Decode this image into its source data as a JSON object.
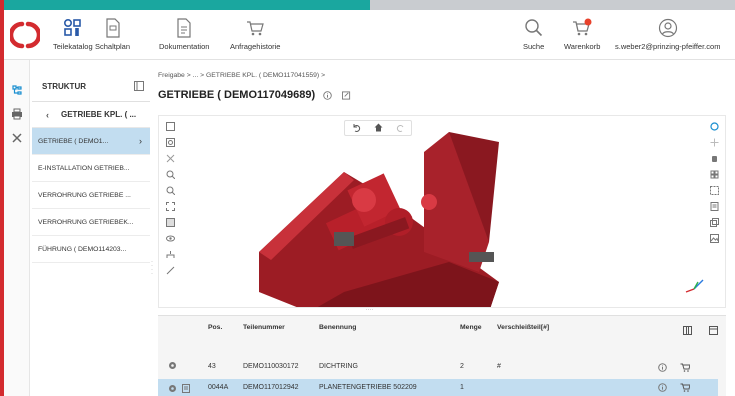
{
  "header": {
    "nav": [
      {
        "label": "Teilekatalog",
        "icon": "catalog-icon"
      },
      {
        "label": "Schaltplan",
        "icon": "circuit-diagram-icon"
      },
      {
        "label": "Dokumentation",
        "icon": "documentation-icon"
      },
      {
        "label": "Anfragehistorie",
        "icon": "request-history-icon"
      }
    ],
    "search_label": "Suche",
    "cart_label": "Warenkorb",
    "user_email": "s.weber2@prinzing-pfeiffer.com",
    "cart_badge_color": "#e8412b"
  },
  "structure": {
    "heading": "STRUKTUR",
    "parent": "GETRIEBE KPL. ( ...",
    "items": [
      {
        "label": "GETRIEBE ( DEMO1..."
      },
      {
        "label": "E-INSTALLATION GETRIEB..."
      },
      {
        "label": "VERROHRUNG GETRIEBE ..."
      },
      {
        "label": "VERROHRUNG GETRIEBEK..."
      },
      {
        "label": "FÜHRUNG ( DEMO114203..."
      }
    ]
  },
  "breadcrumb": "Freigabe > ... > GETRIEBE KPL. ( DEMO117041559) >",
  "title": "GETRIEBE ( DEMO117049689)",
  "table": {
    "columns": {
      "pos": "Pos.",
      "part": "Teilenummer",
      "name": "Benennung",
      "qty": "Menge",
      "wear": "Verschleißteil[#]"
    },
    "rows": [
      {
        "pos": "43",
        "part": "DEMO110030172",
        "name": "DICHTRING",
        "qty": "2",
        "wear": "#"
      },
      {
        "pos": "0044A",
        "part": "DEMO117012942",
        "name": "PLANETENGETRIEBE 502209",
        "qty": "1",
        "wear": ""
      }
    ]
  },
  "colors": {
    "accent": "#1aa79f",
    "brand_red": "#d32b2f",
    "selection": "#c2ddf0",
    "model_red": "#b8202a"
  }
}
